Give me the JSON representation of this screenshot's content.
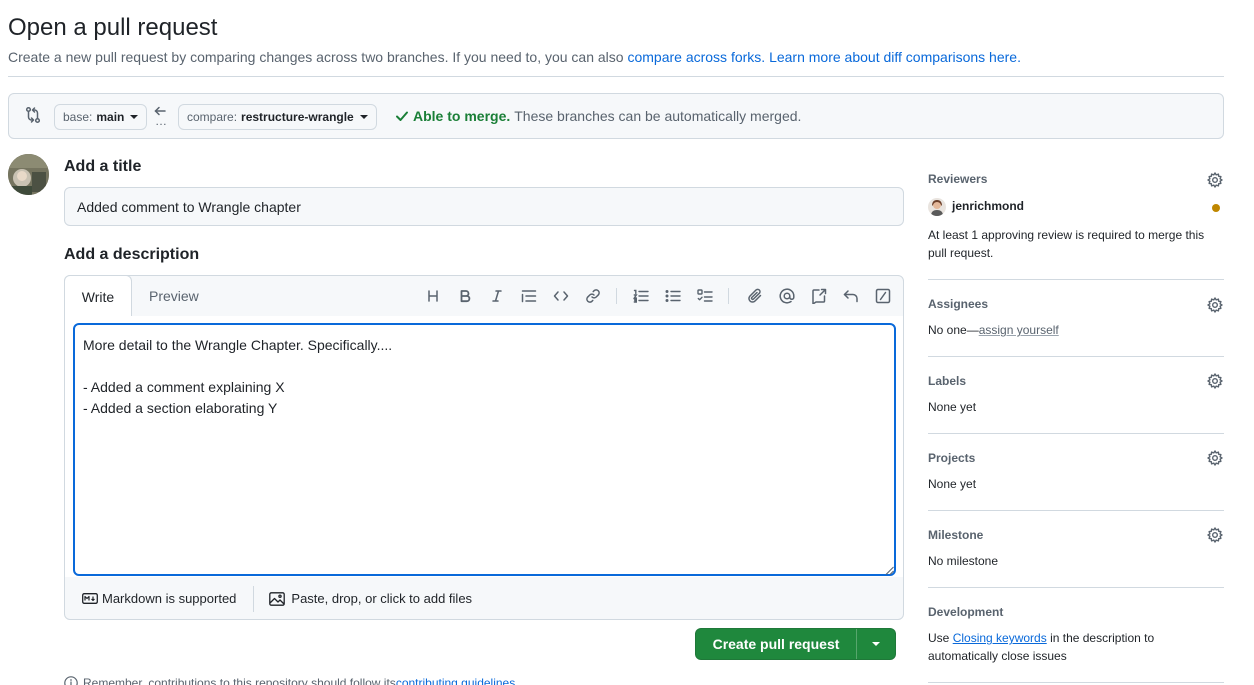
{
  "header": {
    "title": "Open a pull request",
    "subtitle_prefix": "Create a new pull request by comparing changes across two branches. If you need to, you can also ",
    "compare_forks_link": "compare across forks.",
    "learn_more_link": "Learn more about diff comparisons here."
  },
  "compare": {
    "base_label": "base:",
    "base_value": "main",
    "compare_label": "compare:",
    "compare_value": "restructure-wrangle",
    "arrow_dots": "…",
    "status_bold": "Able to merge.",
    "status_text": "These branches can be automatically merged."
  },
  "form": {
    "title_heading": "Add a title",
    "title_value": "Added comment to Wrangle chapter",
    "description_heading": "Add a description",
    "tab_write": "Write",
    "tab_preview": "Preview",
    "description_value": "More detail to the Wrangle Chapter. Specifically....\n\n- Added a comment explaining X\n- Added a section elaborating Y",
    "markdown_note": "Markdown is supported",
    "attach_note": "Paste, drop, or click to add files",
    "submit_label": "Create pull request",
    "reminder_prefix": "Remember, contributions to this repository should follow its ",
    "reminder_link": "contributing guidelines"
  },
  "toolbar": {
    "icons": [
      "heading-icon",
      "bold-icon",
      "italic-icon",
      "quote-icon",
      "code-icon",
      "link-icon",
      "numbered-list-icon",
      "unordered-list-icon",
      "task-list-icon",
      "attach-icon",
      "mention-icon",
      "reference-icon",
      "undo-icon",
      "slash-commands-icon"
    ]
  },
  "sidebar": {
    "reviewers": {
      "title": "Reviewers",
      "user": "jenrichmond",
      "note_line1": "At least 1 approving review is required to merge this",
      "note_line2": "pull request."
    },
    "assignees": {
      "title": "Assignees",
      "prefix": "No one—",
      "link": "assign yourself"
    },
    "labels": {
      "title": "Labels",
      "value": "None yet"
    },
    "projects": {
      "title": "Projects",
      "value": "None yet"
    },
    "milestone": {
      "title": "Milestone",
      "value": "No milestone"
    },
    "development": {
      "title": "Development",
      "prefix": "Use ",
      "link": "Closing keywords",
      "suffix": " in the description to",
      "line2": "automatically close issues"
    }
  },
  "colors": {
    "accent": "#0969da",
    "success": "#1a7f37",
    "button_green": "#1f883d",
    "pending_dot": "#bf8700"
  }
}
